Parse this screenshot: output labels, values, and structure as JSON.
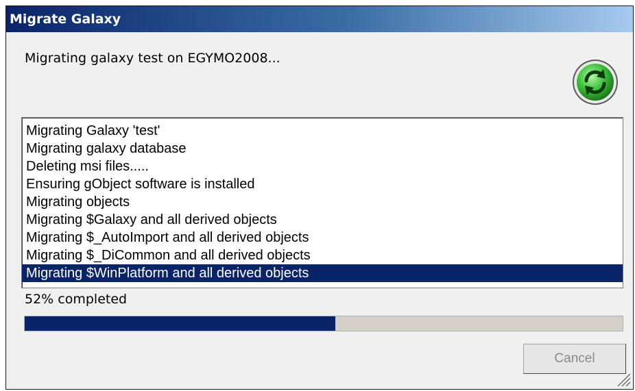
{
  "window": {
    "title": "Migrate Galaxy"
  },
  "message": "Migrating galaxy test on EGYMO2008...",
  "log": {
    "items": [
      "Migrating Galaxy 'test'",
      "Migrating galaxy database",
      "Deleting msi files.....",
      "Ensuring gObject software is installed",
      "Migrating objects",
      "Migrating $Galaxy and all derived objects",
      "Migrating $_AutoImport and all derived objects",
      "Migrating $_DiCommon and all derived objects",
      "Migrating $WinPlatform and all derived objects"
    ],
    "selected_index": 8
  },
  "progress": {
    "label": "52% completed",
    "fraction": 0.52
  },
  "buttons": {
    "cancel": "Cancel"
  },
  "icons": {
    "status": "refresh-icon",
    "resize": "resize-grip-icon"
  },
  "colors": {
    "title_bar": "#0a246a",
    "selection": "#0a246a",
    "progress_fill": "#0a246a",
    "icon_green": "#2fb52f"
  }
}
